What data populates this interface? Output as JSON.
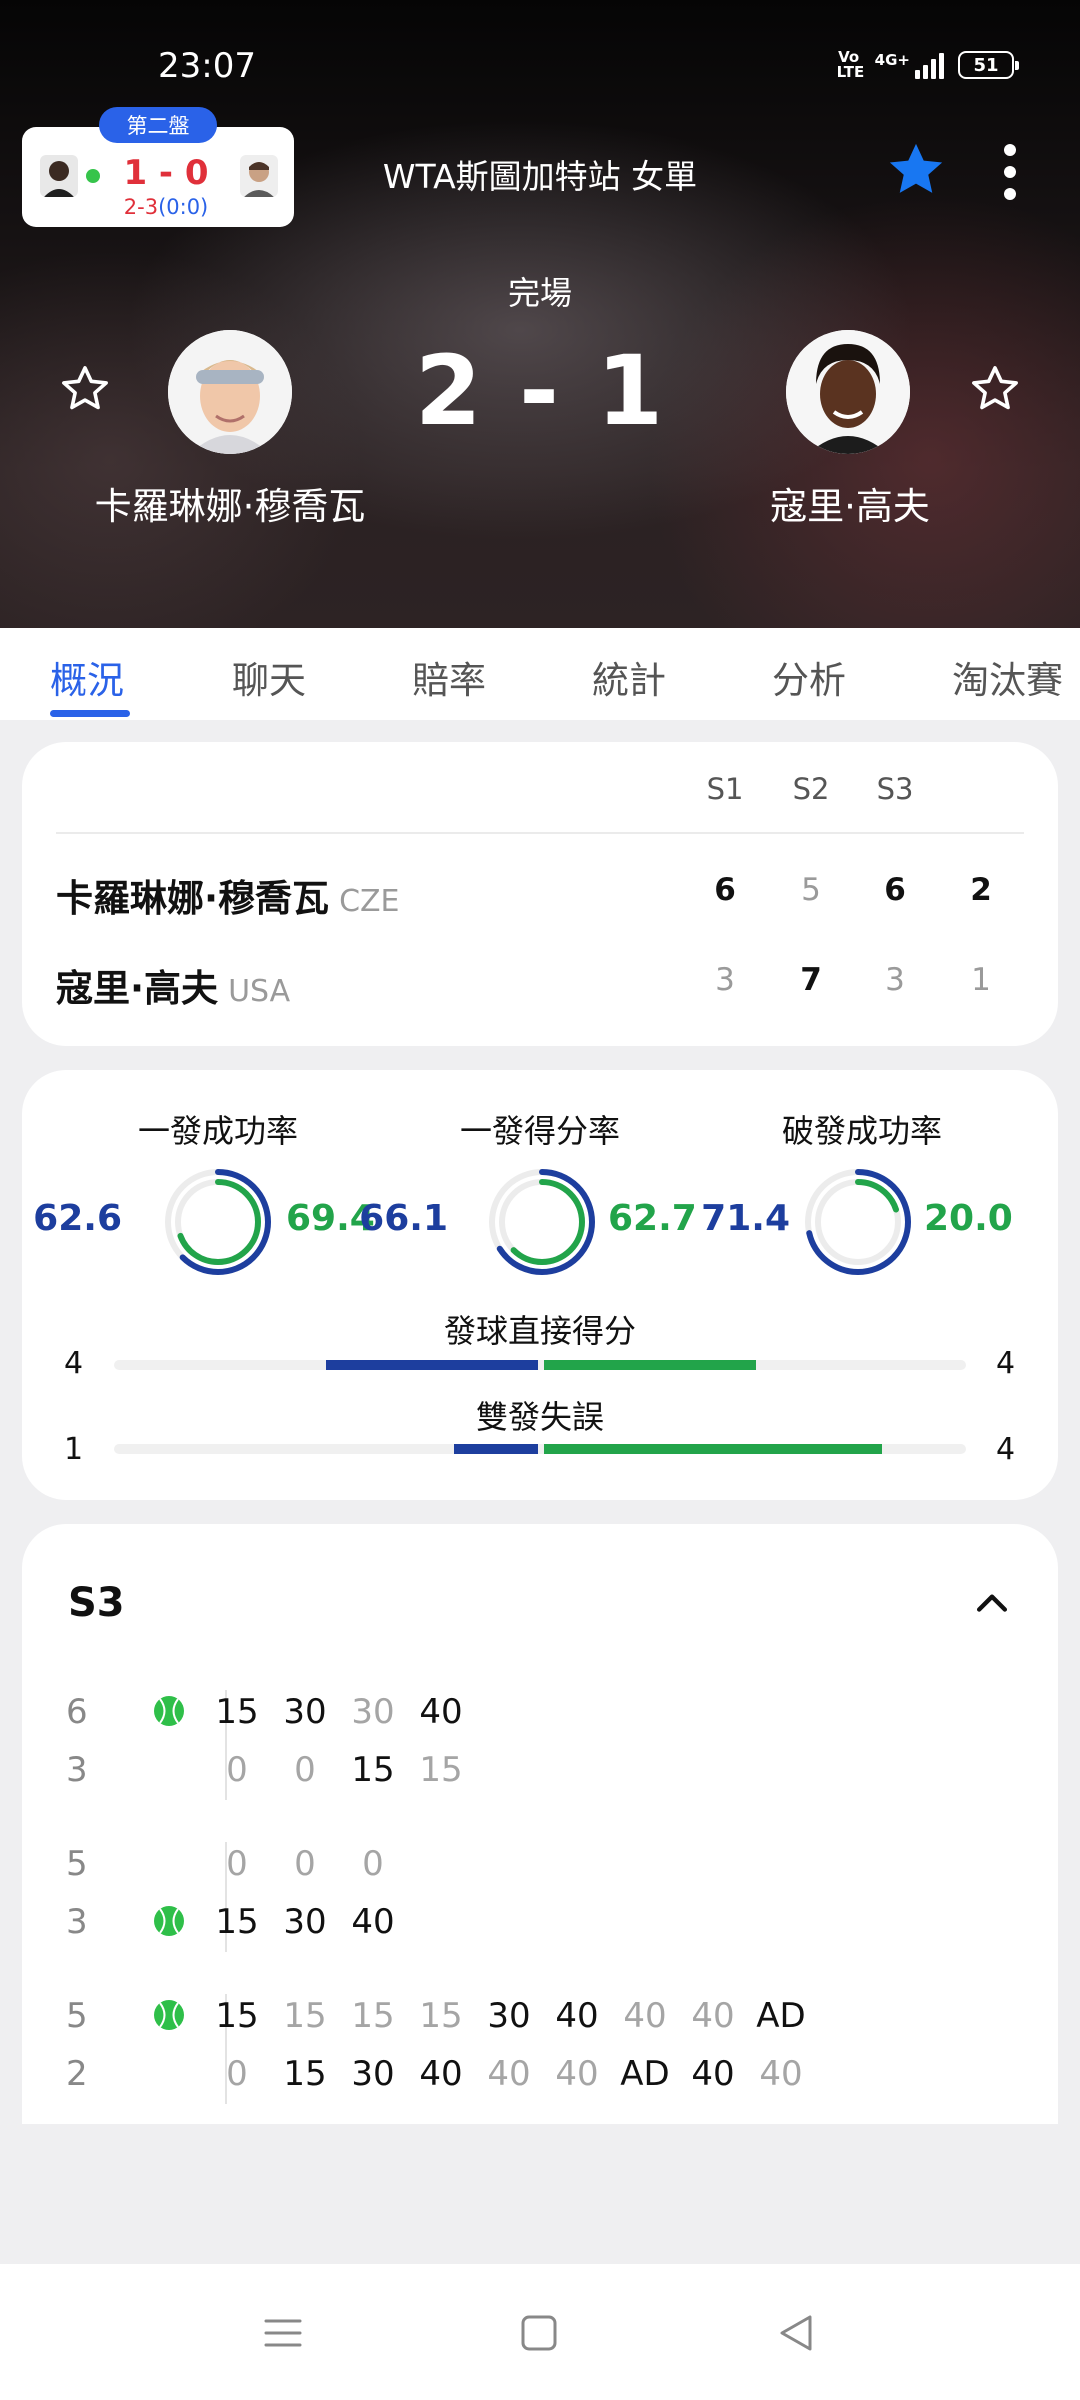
{
  "status_bar": {
    "time": "23:07",
    "volte": "Vo LTE",
    "network": "4G+",
    "battery": "51"
  },
  "mini_card": {
    "badge": "第二盤",
    "score": "1 - 0",
    "sub_red": "2-3",
    "sub_blue": "(0:0)"
  },
  "header": {
    "competition": "WTA斯圖加特站 女單",
    "status": "完場",
    "score": "2 - 1"
  },
  "players": {
    "home": "卡羅琳娜·穆喬瓦",
    "away": "寇里·高夫"
  },
  "tabs": [
    "概況",
    "聊天",
    "賠率",
    "統計",
    "分析",
    "淘汰賽"
  ],
  "scoreboard": {
    "columns": [
      "S1",
      "S2",
      "S3"
    ],
    "rows": [
      {
        "name": "卡羅琳娜·穆喬瓦",
        "country": "CZE",
        "sets": [
          "6",
          "5",
          "6"
        ],
        "total": "2"
      },
      {
        "name": "寇里·高夫",
        "country": "USA",
        "sets": [
          "3",
          "7",
          "3"
        ],
        "total": "1"
      }
    ]
  },
  "stats": {
    "rings": [
      {
        "label": "一發成功率",
        "left": "62.6",
        "right": "69.4"
      },
      {
        "label": "一發得分率",
        "left": "66.1",
        "right": "62.7"
      },
      {
        "label": "破發成功率",
        "left": "71.4",
        "right": "20.0"
      }
    ],
    "bars": [
      {
        "label": "發球直接得分",
        "left": "4",
        "right": "4"
      },
      {
        "label": "雙發失誤",
        "left": "1",
        "right": "4"
      }
    ]
  },
  "point_by_point": {
    "set_title": "S3",
    "games": [
      {
        "top_num": "6",
        "bottom_num": "3",
        "top_points": [
          "15",
          "30",
          "30",
          "40"
        ],
        "bottom_points": [
          "0",
          "0",
          "15",
          "15"
        ]
      },
      {
        "top_num": "5",
        "bottom_num": "3",
        "top_points": [
          "0",
          "0",
          "0"
        ],
        "bottom_points": [
          "15",
          "30",
          "40"
        ]
      },
      {
        "top_num": "5",
        "bottom_num": "2",
        "top_points": [
          "15",
          "15",
          "15",
          "15",
          "30",
          "40",
          "40",
          "40",
          "AD"
        ],
        "bottom_points": [
          "0",
          "15",
          "30",
          "40",
          "40",
          "40",
          "AD",
          "40",
          "40"
        ]
      }
    ]
  },
  "colors": {
    "accent": "#2a62e8",
    "home": "#1d3e9e",
    "away": "#22a44a",
    "live_red": "#e0303a",
    "star": "#1877f2"
  },
  "icons": [
    "star-filled-icon",
    "star-outline-icon",
    "more-vertical-icon",
    "chevron-up-icon",
    "tennis-ball-icon",
    "menu-icon",
    "home-square-icon",
    "back-triangle-icon"
  ]
}
